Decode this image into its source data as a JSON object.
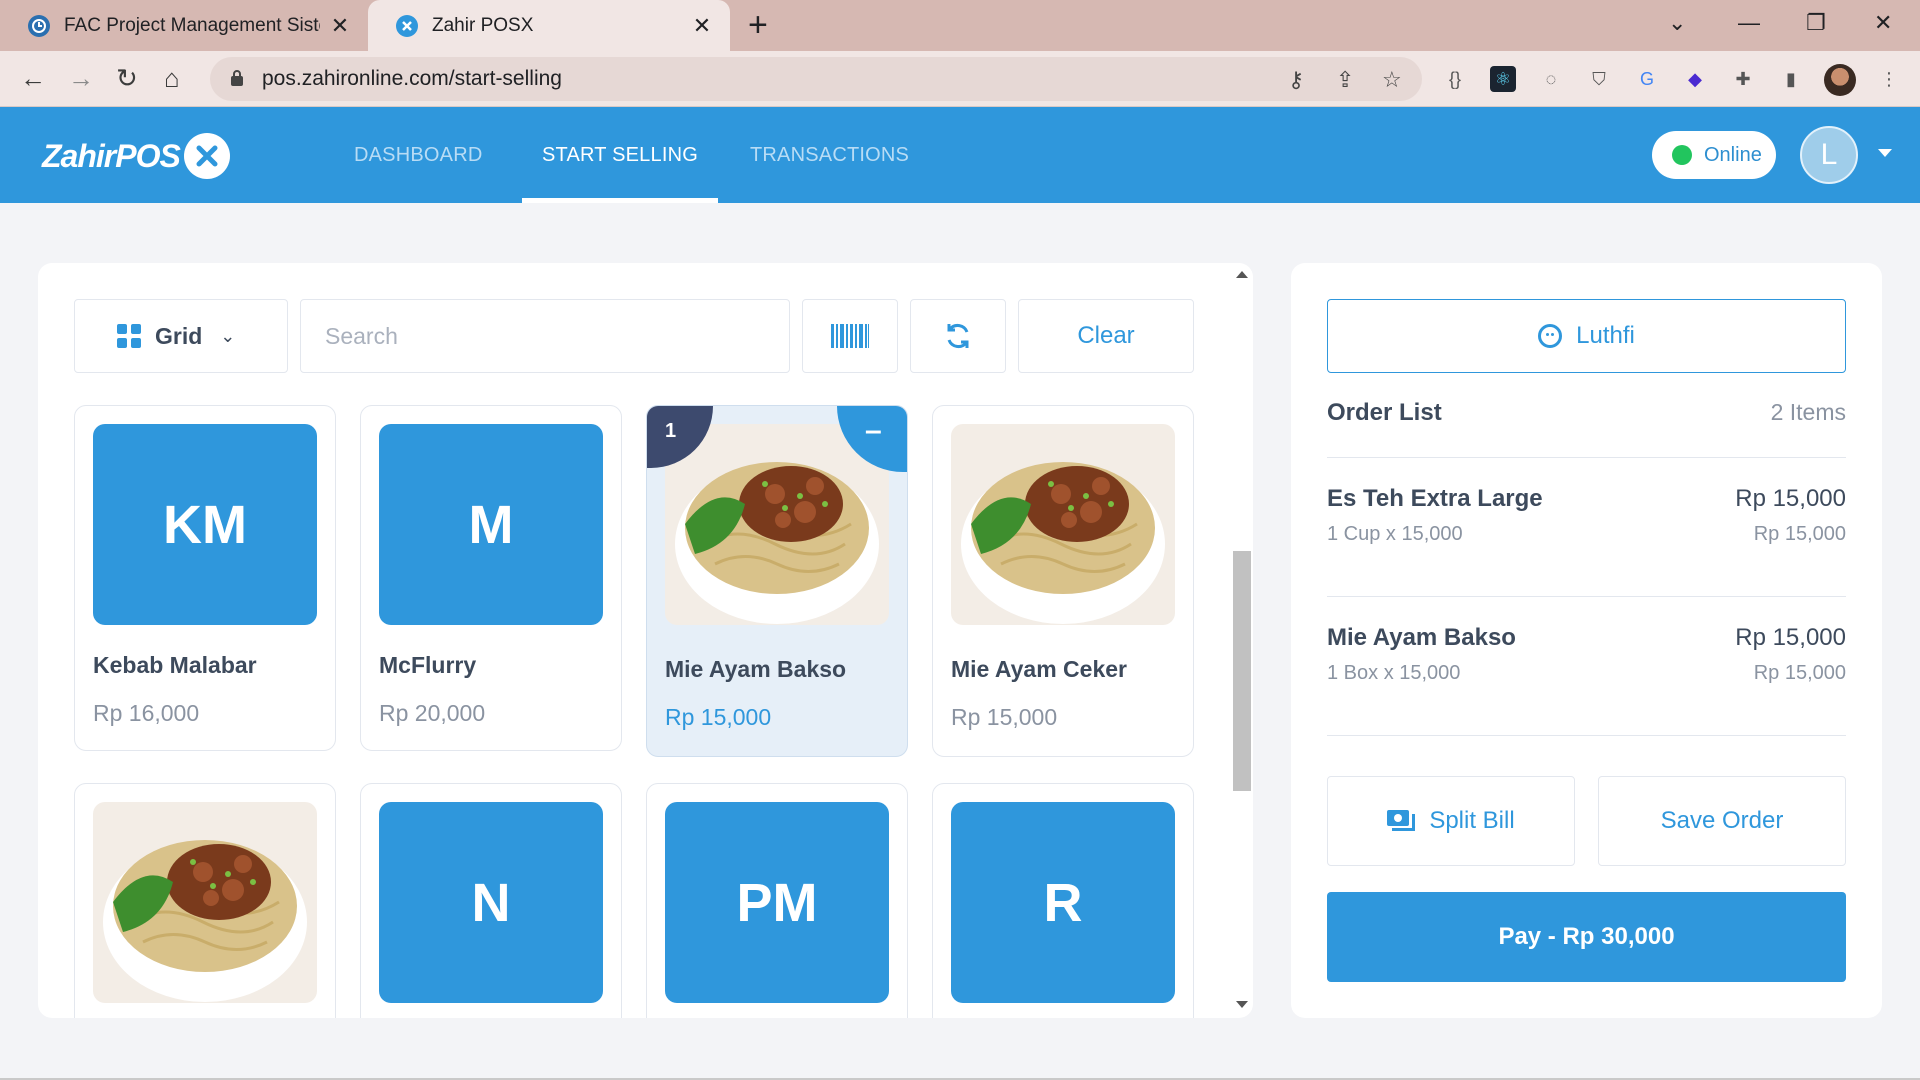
{
  "browser": {
    "tabs": [
      {
        "title": "FAC Project Management Sistem"
      },
      {
        "title": "Zahir POSX"
      }
    ],
    "url": "pos.zahironline.com/start-selling"
  },
  "app": {
    "logo_text": "ZahirPOS",
    "nav": [
      "DASHBOARD",
      "START SELLING",
      "TRANSACTIONS"
    ],
    "active_nav": "START SELLING",
    "status": "Online",
    "avatar_initial": "L",
    "accent_color": "#2f97dc"
  },
  "toolbar": {
    "view_mode": "Grid",
    "search_placeholder": "Search",
    "clear_label": "Clear"
  },
  "products": [
    {
      "initials": "KM",
      "name": "Kebab Malabar",
      "price": "Rp 16,000",
      "image": null
    },
    {
      "initials": "M",
      "name": "McFlurry",
      "price": "Rp 20,000",
      "image": null
    },
    {
      "initials": "",
      "name": "Mie Ayam Bakso",
      "price": "Rp 15,000",
      "image": "noodle-bowl",
      "selected": true,
      "qty": "1"
    },
    {
      "initials": "",
      "name": "Mie Ayam Ceker",
      "price": "Rp 15,000",
      "image": "noodle-bowl"
    },
    {
      "initials": "",
      "name": "",
      "price": "",
      "image": "noodle-bowl"
    },
    {
      "initials": "N",
      "name": "",
      "price": "",
      "image": null
    },
    {
      "initials": "PM",
      "name": "",
      "price": "",
      "image": null
    },
    {
      "initials": "R",
      "name": "",
      "price": "",
      "image": null
    }
  ],
  "order": {
    "customer": "Luthfi",
    "title": "Order List",
    "count": "2 Items",
    "items": [
      {
        "name": "Es Teh Extra Large",
        "detail": "1 Cup x 15,000",
        "total": "Rp 15,000",
        "subtotal": "Rp 15,000"
      },
      {
        "name": "Mie Ayam Bakso",
        "detail": "1 Box x 15,000",
        "total": "Rp 15,000",
        "subtotal": "Rp 15,000"
      }
    ],
    "split_label": "Split Bill",
    "save_label": "Save Order",
    "pay_label": "Pay - Rp 30,000"
  }
}
